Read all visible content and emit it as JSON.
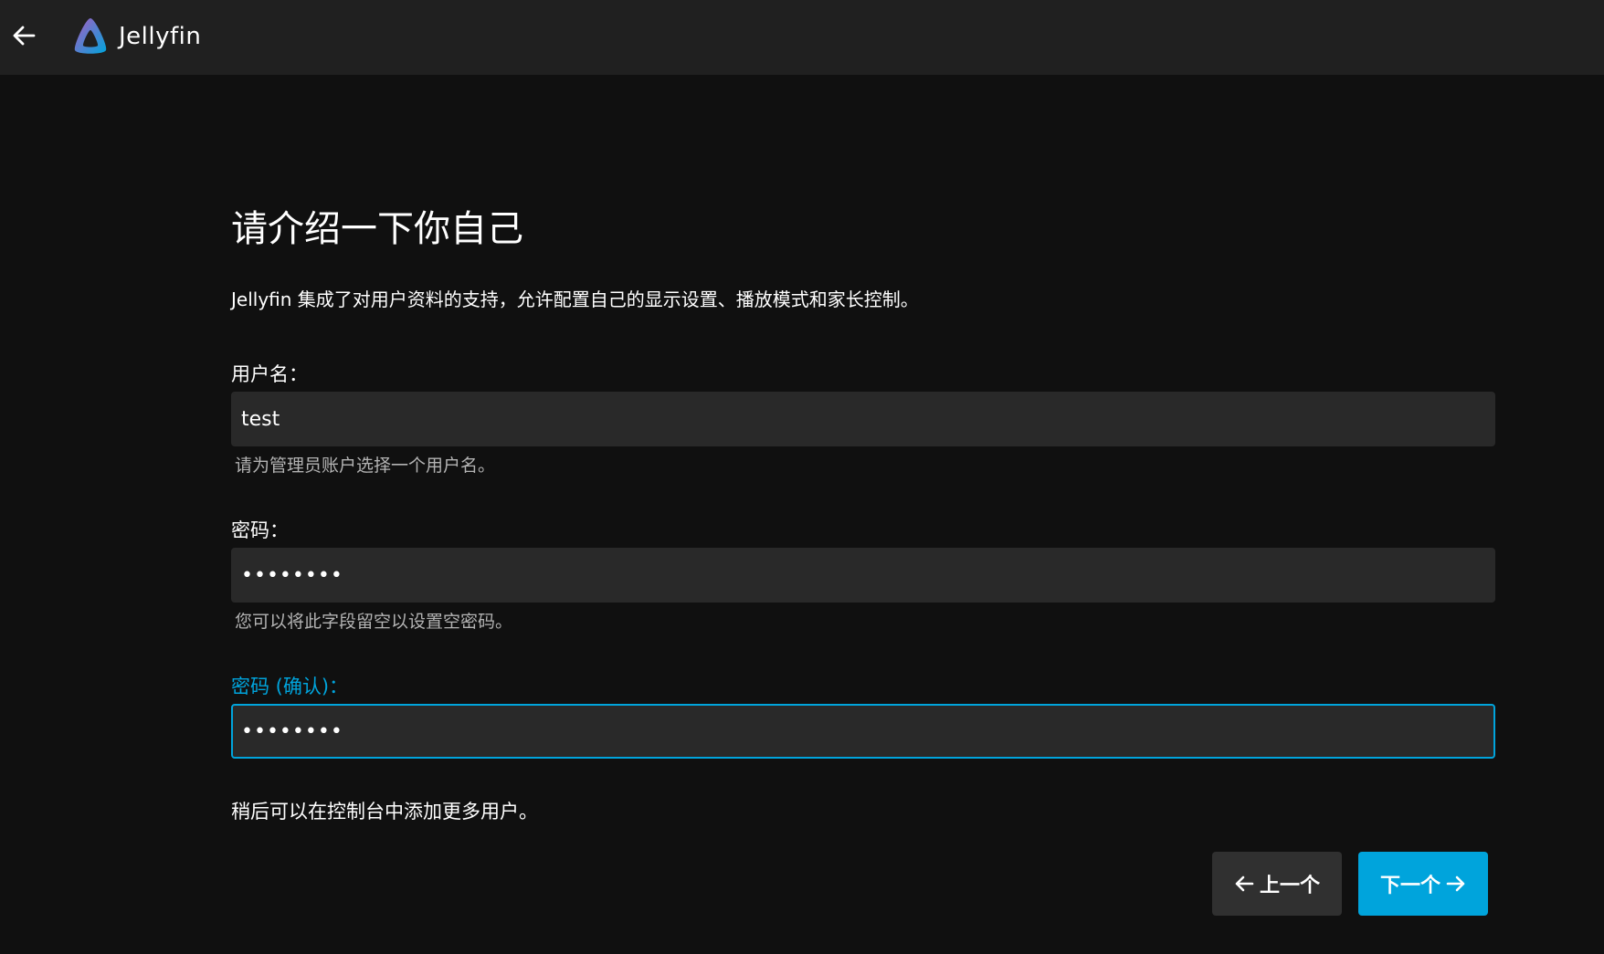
{
  "header": {
    "app_name": "Jellyfin"
  },
  "wizard": {
    "title": "请介绍一下你自己",
    "intro": "Jellyfin 集成了对用户资料的支持，允许配置自己的显示设置、播放模式和家长控制。",
    "username": {
      "label": "用户名：",
      "value": "test",
      "hint": "请为管理员账户选择一个用户名。"
    },
    "password": {
      "label": "密码：",
      "value": "••••••••",
      "hint": "您可以将此字段留空以设置空密码。"
    },
    "password_confirm": {
      "label": "密码 (确认)：",
      "value": "••••••••"
    },
    "note": "稍后可以在控制台中添加更多用户。",
    "buttons": {
      "prev_label": "上一个",
      "next_label": "下一个"
    }
  },
  "colors": {
    "accent": "#00a4dc",
    "background": "#101010",
    "header": "#202020",
    "input": "#292929"
  },
  "icons": {
    "back": "arrow-left-icon",
    "logo": "jellyfin-logo-icon",
    "prev": "arrow-left-icon",
    "next": "arrow-right-icon"
  }
}
